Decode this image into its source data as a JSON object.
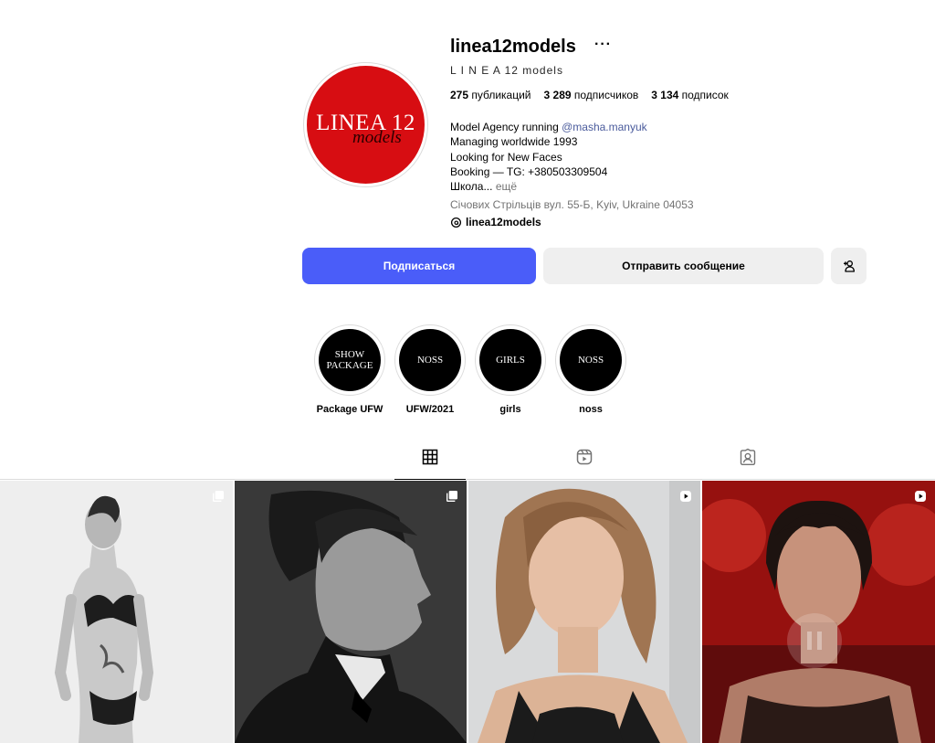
{
  "profile": {
    "username": "linea12models",
    "more_icon": "···",
    "full_name": "L I N E A 12 models",
    "avatar": {
      "brand_text": "LINEA 12",
      "script_text": "models",
      "color": "#d70d12"
    },
    "stats": {
      "posts_count": "275",
      "posts_label": "публикаций",
      "followers_count": "3 289",
      "followers_label": "подписчиков",
      "following_count": "3 134",
      "following_label": "подписок"
    },
    "bio": {
      "line1_prefix": "Model Agency running ",
      "line1_mention": "@masha.manyuk",
      "line2": "Managing worldwide 1993",
      "line3": "Looking for New Faces",
      "line4": "Booking — TG: +380503309504",
      "line5": "Школа...",
      "more": "ещё"
    },
    "address": "Січових Стрільців вул. 55-Б, Kyiv, Ukraine 04053",
    "threads_handle": "linea12models"
  },
  "actions": {
    "follow_label": "Подписаться",
    "message_label": "Отправить сообщение",
    "add_user_icon": "add-user-icon"
  },
  "highlights": [
    {
      "cover_text": "SHOW PACKAGE",
      "label": "Package UFW"
    },
    {
      "cover_text": "NOSS",
      "label": "UFW/2021"
    },
    {
      "cover_text": "GIRLS",
      "label": "girls"
    },
    {
      "cover_text": "NOSS",
      "label": "noss"
    }
  ],
  "tabs": [
    "grid-icon",
    "reels-icon",
    "tagged-icon"
  ],
  "posts": [
    {
      "type": "carousel",
      "icon": "carousel-icon"
    },
    {
      "type": "carousel",
      "icon": "carousel-icon"
    },
    {
      "type": "reel",
      "icon": "reel-icon"
    },
    {
      "type": "reel",
      "icon": "reel-icon"
    }
  ],
  "colors": {
    "accent": "#4a5df9",
    "secondary_button": "#efefef",
    "mention": "#4a5b9c",
    "muted": "#737373"
  }
}
